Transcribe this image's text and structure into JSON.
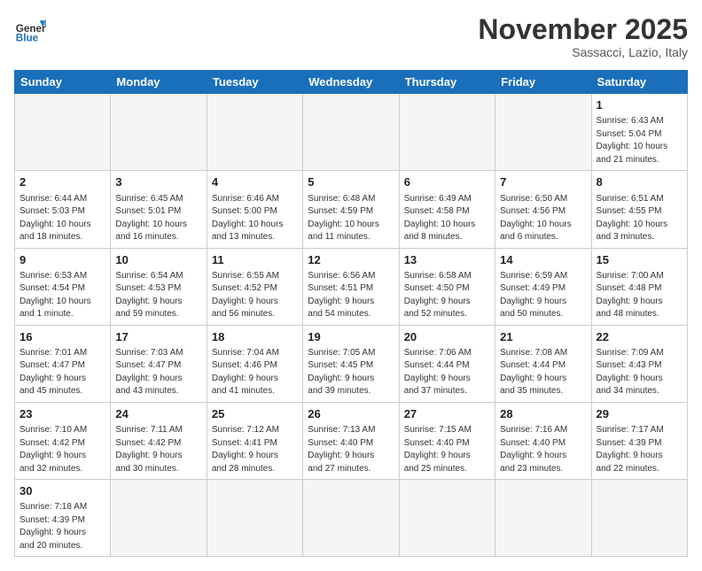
{
  "header": {
    "logo_general": "General",
    "logo_blue": "Blue",
    "month": "November 2025",
    "location": "Sassacci, Lazio, Italy"
  },
  "weekdays": [
    "Sunday",
    "Monday",
    "Tuesday",
    "Wednesday",
    "Thursday",
    "Friday",
    "Saturday"
  ],
  "weeks": [
    [
      {
        "day": null,
        "info": null
      },
      {
        "day": null,
        "info": null
      },
      {
        "day": null,
        "info": null
      },
      {
        "day": null,
        "info": null
      },
      {
        "day": null,
        "info": null
      },
      {
        "day": null,
        "info": null
      },
      {
        "day": "1",
        "info": "Sunrise: 6:43 AM\nSunset: 5:04 PM\nDaylight: 10 hours\nand 21 minutes."
      }
    ],
    [
      {
        "day": "2",
        "info": "Sunrise: 6:44 AM\nSunset: 5:03 PM\nDaylight: 10 hours\nand 18 minutes."
      },
      {
        "day": "3",
        "info": "Sunrise: 6:45 AM\nSunset: 5:01 PM\nDaylight: 10 hours\nand 16 minutes."
      },
      {
        "day": "4",
        "info": "Sunrise: 6:46 AM\nSunset: 5:00 PM\nDaylight: 10 hours\nand 13 minutes."
      },
      {
        "day": "5",
        "info": "Sunrise: 6:48 AM\nSunset: 4:59 PM\nDaylight: 10 hours\nand 11 minutes."
      },
      {
        "day": "6",
        "info": "Sunrise: 6:49 AM\nSunset: 4:58 PM\nDaylight: 10 hours\nand 8 minutes."
      },
      {
        "day": "7",
        "info": "Sunrise: 6:50 AM\nSunset: 4:56 PM\nDaylight: 10 hours\nand 6 minutes."
      },
      {
        "day": "8",
        "info": "Sunrise: 6:51 AM\nSunset: 4:55 PM\nDaylight: 10 hours\nand 3 minutes."
      }
    ],
    [
      {
        "day": "9",
        "info": "Sunrise: 6:53 AM\nSunset: 4:54 PM\nDaylight: 10 hours\nand 1 minute."
      },
      {
        "day": "10",
        "info": "Sunrise: 6:54 AM\nSunset: 4:53 PM\nDaylight: 9 hours\nand 59 minutes."
      },
      {
        "day": "11",
        "info": "Sunrise: 6:55 AM\nSunset: 4:52 PM\nDaylight: 9 hours\nand 56 minutes."
      },
      {
        "day": "12",
        "info": "Sunrise: 6:56 AM\nSunset: 4:51 PM\nDaylight: 9 hours\nand 54 minutes."
      },
      {
        "day": "13",
        "info": "Sunrise: 6:58 AM\nSunset: 4:50 PM\nDaylight: 9 hours\nand 52 minutes."
      },
      {
        "day": "14",
        "info": "Sunrise: 6:59 AM\nSunset: 4:49 PM\nDaylight: 9 hours\nand 50 minutes."
      },
      {
        "day": "15",
        "info": "Sunrise: 7:00 AM\nSunset: 4:48 PM\nDaylight: 9 hours\nand 48 minutes."
      }
    ],
    [
      {
        "day": "16",
        "info": "Sunrise: 7:01 AM\nSunset: 4:47 PM\nDaylight: 9 hours\nand 45 minutes."
      },
      {
        "day": "17",
        "info": "Sunrise: 7:03 AM\nSunset: 4:47 PM\nDaylight: 9 hours\nand 43 minutes."
      },
      {
        "day": "18",
        "info": "Sunrise: 7:04 AM\nSunset: 4:46 PM\nDaylight: 9 hours\nand 41 minutes."
      },
      {
        "day": "19",
        "info": "Sunrise: 7:05 AM\nSunset: 4:45 PM\nDaylight: 9 hours\nand 39 minutes."
      },
      {
        "day": "20",
        "info": "Sunrise: 7:06 AM\nSunset: 4:44 PM\nDaylight: 9 hours\nand 37 minutes."
      },
      {
        "day": "21",
        "info": "Sunrise: 7:08 AM\nSunset: 4:44 PM\nDaylight: 9 hours\nand 35 minutes."
      },
      {
        "day": "22",
        "info": "Sunrise: 7:09 AM\nSunset: 4:43 PM\nDaylight: 9 hours\nand 34 minutes."
      }
    ],
    [
      {
        "day": "23",
        "info": "Sunrise: 7:10 AM\nSunset: 4:42 PM\nDaylight: 9 hours\nand 32 minutes."
      },
      {
        "day": "24",
        "info": "Sunrise: 7:11 AM\nSunset: 4:42 PM\nDaylight: 9 hours\nand 30 minutes."
      },
      {
        "day": "25",
        "info": "Sunrise: 7:12 AM\nSunset: 4:41 PM\nDaylight: 9 hours\nand 28 minutes."
      },
      {
        "day": "26",
        "info": "Sunrise: 7:13 AM\nSunset: 4:40 PM\nDaylight: 9 hours\nand 27 minutes."
      },
      {
        "day": "27",
        "info": "Sunrise: 7:15 AM\nSunset: 4:40 PM\nDaylight: 9 hours\nand 25 minutes."
      },
      {
        "day": "28",
        "info": "Sunrise: 7:16 AM\nSunset: 4:40 PM\nDaylight: 9 hours\nand 23 minutes."
      },
      {
        "day": "29",
        "info": "Sunrise: 7:17 AM\nSunset: 4:39 PM\nDaylight: 9 hours\nand 22 minutes."
      }
    ],
    [
      {
        "day": "30",
        "info": "Sunrise: 7:18 AM\nSunset: 4:39 PM\nDaylight: 9 hours\nand 20 minutes."
      },
      {
        "day": null,
        "info": null
      },
      {
        "day": null,
        "info": null
      },
      {
        "day": null,
        "info": null
      },
      {
        "day": null,
        "info": null
      },
      {
        "day": null,
        "info": null
      },
      {
        "day": null,
        "info": null
      }
    ]
  ]
}
